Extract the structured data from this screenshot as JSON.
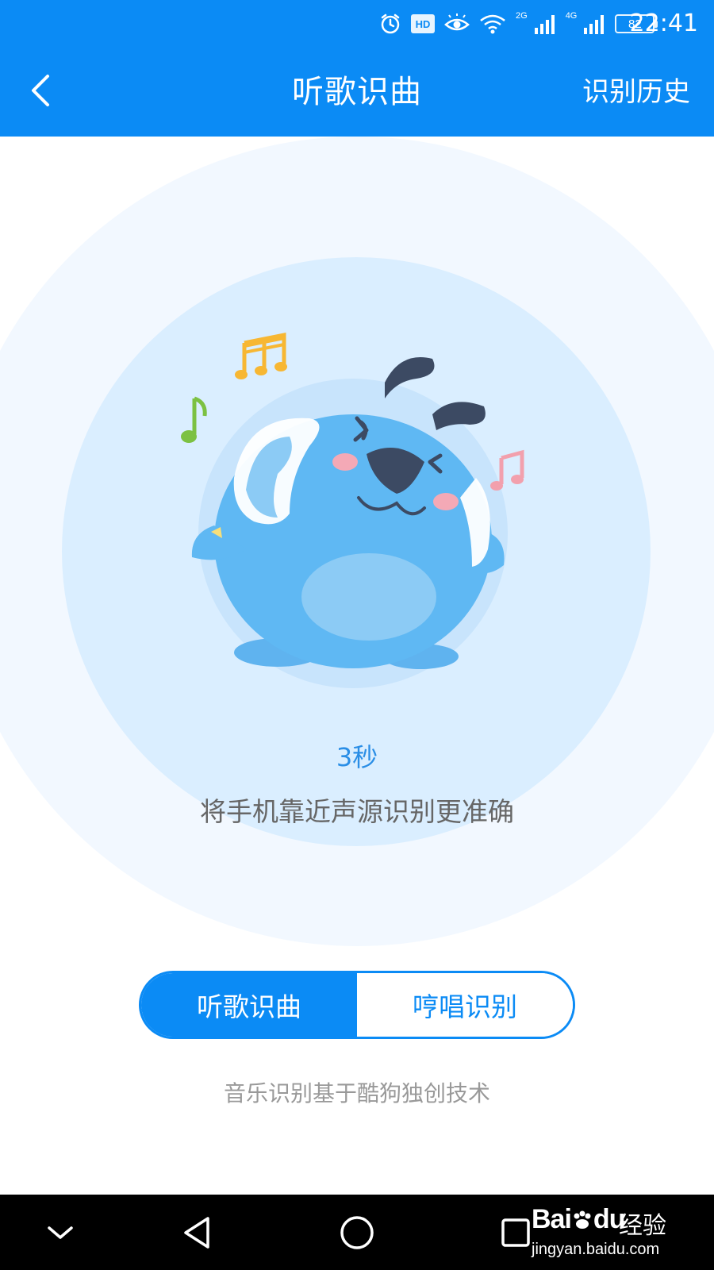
{
  "status_bar": {
    "time": "22:41",
    "battery": "82",
    "hd_label": "HD",
    "net_2g_label": "2G",
    "net_4g_label": "4G",
    "icons": [
      "alarm-icon",
      "hd-icon",
      "eye-comfort-icon",
      "wifi-icon",
      "signal-2g-icon",
      "signal-4g-icon",
      "battery-icon"
    ]
  },
  "header": {
    "title": "听歌识曲",
    "history_label": "识别历史",
    "back_icon": "chevron-left-icon"
  },
  "main": {
    "countdown": "3秒",
    "hint": "将手机靠近声源识别更准确",
    "mode_tabs": [
      {
        "label": "听歌识曲",
        "active": true
      },
      {
        "label": "哼唱识别",
        "active": false
      }
    ],
    "footer_note": "音乐识别基于酷狗独创技术"
  },
  "navbar": {
    "icons": [
      "collapse-chevron-down-icon",
      "back-triangle-icon",
      "home-circle-icon",
      "recent-square-icon"
    ]
  },
  "watermark": {
    "brand": "Bai",
    "brand_suffix": "du",
    "jingyan": "经验",
    "url": "jingyan.baidu.com"
  },
  "colors": {
    "primary": "#0b8bf5",
    "outer_ring": "#f2f8ff",
    "inner_ring": "#daeeff",
    "countdown_text": "#2a8ee6",
    "hint_text": "#666666",
    "footer_text": "#999999"
  }
}
